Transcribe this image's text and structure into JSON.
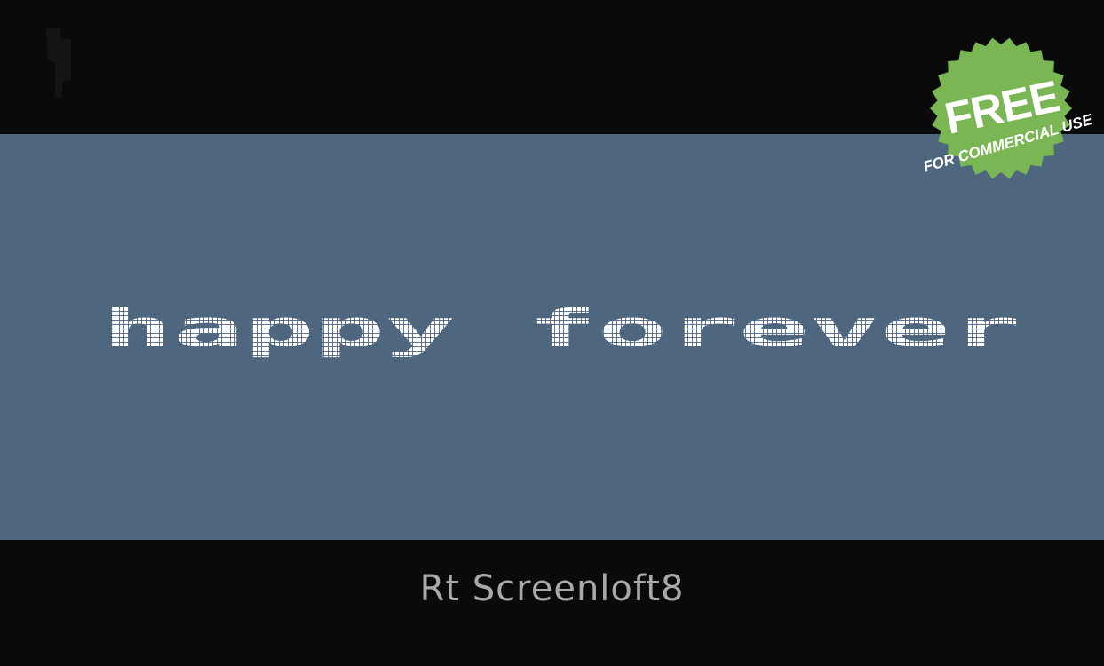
{
  "preview": {
    "sample_text": "happy forever",
    "font_name": "Rt Screenloft8"
  },
  "badge": {
    "title": "FREE",
    "subtitle": "FOR COMMERCIAL USE",
    "color": "#7ab654"
  },
  "colors": {
    "background": "#0a0a0b",
    "band": "#4f667f",
    "sample_text": "#ffffff",
    "font_name": "#a9a9a9"
  }
}
